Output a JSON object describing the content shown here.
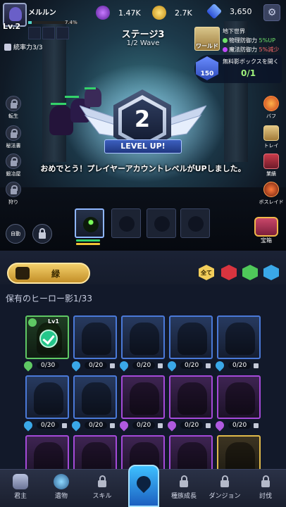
{
  "player": {
    "name": "メルルン",
    "level": "Lv.2",
    "xp_percent": "7.4%",
    "xp_fraction": 0.074,
    "command_label": "統率力3/3"
  },
  "resources": {
    "purple_gem": "1.47K",
    "gold": "2.7K",
    "blue_gem": "3,650"
  },
  "stage": {
    "title": "ステージ3",
    "wave": "1/2 Wave"
  },
  "world": {
    "button_label": "ワールド",
    "title": "地下世界",
    "phys_label": "物理防御力",
    "phys_value": "5%UP",
    "magic_label": "魔法防御力",
    "magic_value": "5%減少"
  },
  "box": {
    "count": "150",
    "label": "無料影ボックスを開く",
    "progress": "0/1"
  },
  "left_side": [
    {
      "label": "転生"
    },
    {
      "label": "秘法書"
    },
    {
      "label": "鍛冶屋"
    },
    {
      "label": "狩り"
    }
  ],
  "right_side": [
    {
      "label": "バフ"
    },
    {
      "label": "トレイ"
    },
    {
      "label": "業績"
    },
    {
      "label": "ボスレイド"
    }
  ],
  "level_up": {
    "number": "2",
    "ribbon": "LEVEL UP!",
    "message": "おめでとう！プレイヤーアカウントレベルがUPしました。"
  },
  "battle_controls": {
    "auto": "自動",
    "treasure": "宝箱"
  },
  "panel": {
    "rarity_label": "緑",
    "owned_label": "保有のヒーロー影1/33",
    "filters": [
      "全て",
      "",
      "",
      ""
    ]
  },
  "hero_cards": [
    {
      "level": "Lv1",
      "count": "0/30"
    },
    {
      "count": "0/20"
    },
    {
      "count": "0/20"
    },
    {
      "count": "0/20"
    },
    {
      "count": "0/20"
    },
    {
      "count": "0/20"
    },
    {
      "count": "0/20"
    },
    {
      "count": "0/20"
    },
    {
      "count": "0/20"
    },
    {
      "count": "0/20"
    }
  ],
  "nav": [
    "君主",
    "遺物",
    "スキル",
    "",
    "種族成長",
    "ダンジョン",
    "討伐"
  ],
  "colors": {
    "accent_gold": "#f3cf6a",
    "accent_blue": "#3ec0ff",
    "up_green": "#6fe26a",
    "down_red": "#ff6a6a"
  }
}
